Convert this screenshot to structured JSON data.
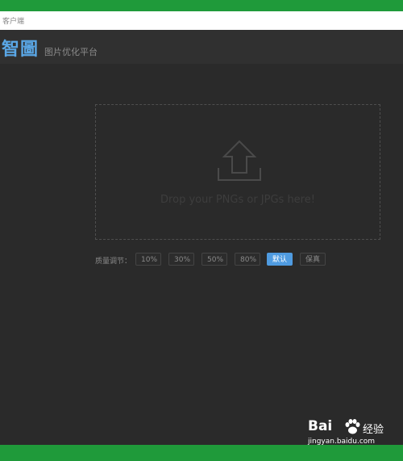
{
  "window": {
    "title": "客户端"
  },
  "header": {
    "logo": "智圖",
    "subtitle": "图片优化平台"
  },
  "dropzone": {
    "icon": "upload-arrow-icon",
    "text": "Drop your PNGs or JPGs here!"
  },
  "quality": {
    "label": "质量调节：",
    "options": [
      "10%",
      "30%",
      "50%",
      "80%",
      "默认",
      "保真"
    ],
    "selected": "默认"
  },
  "watermark": {
    "brand": "Bai",
    "brand_cn": "经验",
    "url": "jingyan.baidu.com"
  },
  "colors": {
    "accent": "#4f9be0",
    "logo": "#5aa7e6",
    "background": "#2a2a2a",
    "frame": "#1f9a3a"
  }
}
